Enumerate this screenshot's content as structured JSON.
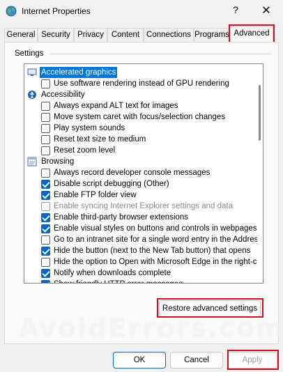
{
  "window": {
    "title": "Internet Properties",
    "help_glyph": "?",
    "close_glyph": "✕"
  },
  "tabs": [
    {
      "label": "General"
    },
    {
      "label": "Security"
    },
    {
      "label": "Privacy"
    },
    {
      "label": "Content"
    },
    {
      "label": "Connections"
    },
    {
      "label": "Programs"
    },
    {
      "label": "Advanced",
      "active": true
    }
  ],
  "settings": {
    "group_label": "Settings",
    "items": [
      {
        "type": "category",
        "label": "Accelerated graphics",
        "icon": "monitor-icon",
        "selected": true
      },
      {
        "type": "option",
        "label": "Use software rendering instead of GPU rendering",
        "checked": false
      },
      {
        "type": "category",
        "label": "Accessibility",
        "icon": "accessibility-icon"
      },
      {
        "type": "option",
        "label": "Always expand ALT text for images",
        "checked": false
      },
      {
        "type": "option",
        "label": "Move system caret with focus/selection changes",
        "checked": false
      },
      {
        "type": "option",
        "label": "Play system sounds",
        "checked": false
      },
      {
        "type": "option",
        "label": "Reset text size to medium",
        "checked": false
      },
      {
        "type": "option",
        "label": "Reset zoom level",
        "checked": false
      },
      {
        "type": "category",
        "label": "Browsing",
        "icon": "document-icon"
      },
      {
        "type": "option",
        "label": "Always record developer console messages",
        "checked": false
      },
      {
        "type": "option",
        "label": "Disable script debugging (Other)",
        "checked": true
      },
      {
        "type": "option",
        "label": "Enable FTP folder view",
        "checked": true
      },
      {
        "type": "option",
        "label": "Enable syncing Internet Explorer settings and data",
        "checked": false,
        "disabled": true
      },
      {
        "type": "option",
        "label": "Enable third-party browser extensions",
        "checked": true
      },
      {
        "type": "option",
        "label": "Enable visual styles on buttons and controls in webpages",
        "checked": true
      },
      {
        "type": "option",
        "label": "Go to an intranet site for a single word entry in the Addres",
        "checked": false
      },
      {
        "type": "option",
        "label": "Hide the button (next to the New Tab button) that opens",
        "checked": true
      },
      {
        "type": "option",
        "label": "Hide the option to Open with Microsoft Edge in the right-cl",
        "checked": false
      },
      {
        "type": "option",
        "label": "Notify when downloads complete",
        "checked": true
      },
      {
        "type": "option",
        "label": "Show friendly HTTP error messages",
        "checked": true
      }
    ]
  },
  "buttons": {
    "restore": "Restore advanced settings",
    "ok": "OK",
    "cancel": "Cancel",
    "apply": "Apply"
  },
  "watermark": "AvoidErrors.com",
  "colors": {
    "highlight": "#d20f1f",
    "selection": "#0078d7",
    "checkbox": "#0067c0"
  }
}
